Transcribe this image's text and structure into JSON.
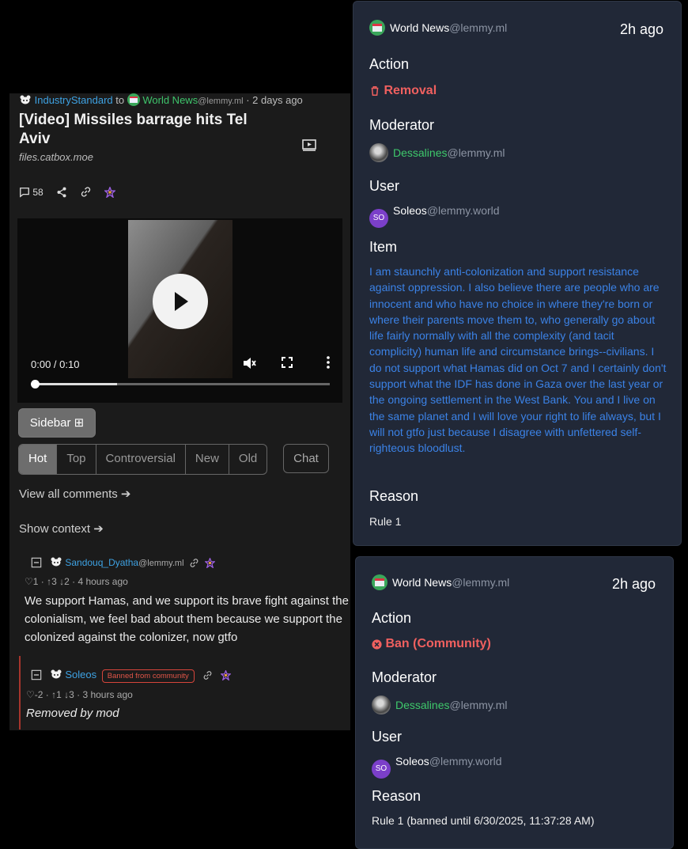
{
  "post": {
    "author": "IndustryStandard",
    "to_word": "to",
    "community": "World News",
    "community_instance": "@lemmy.ml",
    "time": "· 2 days ago",
    "title": "[Video] Missiles barrage hits Tel Aviv",
    "domain": "files.catbox.moe",
    "comment_count": "58",
    "video_time": "0:00 / 0:10",
    "video_progress": 0.28
  },
  "controls": {
    "sidebar_label": "Sidebar ⊞",
    "sort_tabs": [
      "Hot",
      "Top",
      "Controversial",
      "New",
      "Old"
    ],
    "chat_label": "Chat",
    "view_all": "View all comments ➔",
    "show_context": "Show context ➔"
  },
  "comments": [
    {
      "author": "Sandouq_Dyatha",
      "instance": "@lemmy.ml",
      "score_line": "♡1 · ↑3 ↓2 · 4 hours ago",
      "text": "We support Hamas, and we support its brave fight against the colonialism, we feel bad about them because we support the colonized against the colonizer, now gtfo"
    },
    {
      "author": "Soleos",
      "badge": "Banned from community",
      "score_line": "♡-2 · ↑1 ↓3 · 3 hours ago",
      "text": "Removed by mod"
    }
  ],
  "modlog": [
    {
      "community": "World News",
      "community_instance": "@lemmy.ml",
      "ago": "2h ago",
      "action_label": "Action",
      "action": "Removal",
      "moderator_label": "Moderator",
      "moderator": "Dessalines",
      "moderator_instance": "@lemmy.ml",
      "user_label": "User",
      "user_initials": "SO",
      "user": "Soleos",
      "user_instance": "@lemmy.world",
      "item_label": "Item",
      "item": "I am staunchly anti-colonization and support resistance against oppression. I also believe there are people who are innocent and who have no choice in where they're born or where their parents move them to, who generally go about life fairly normally with all the complexity (and tacit complicity) human life and circumstance brings--civilians. I do not support what Hamas did on Oct 7 and I certainly don't support what the IDF has done in Gaza over the last year or the ongoing settlement in the West Bank. You and I live on the same planet and I will love your right to life always, but I will not gtfo just because I disagree with unfettered self-righteous bloodlust.",
      "reason_label": "Reason",
      "reason": "Rule 1"
    },
    {
      "community": "World News",
      "community_instance": "@lemmy.ml",
      "ago": "2h ago",
      "action_label": "Action",
      "action": "Ban (Community)",
      "moderator_label": "Moderator",
      "moderator": "Dessalines",
      "moderator_instance": "@lemmy.ml",
      "user_label": "User",
      "user_initials": "SO",
      "user": "Soleos",
      "user_instance": "@lemmy.world",
      "reason_label": "Reason",
      "reason": "Rule 1 (banned until 6/30/2025, 11:37:28 AM)"
    }
  ],
  "colors": {
    "removal": "#f0605f",
    "moderator": "#3ec96b",
    "item_link": "#3b82e6",
    "user_link": "#3ea2e3"
  },
  "icons": [
    "bear-avatar-icon",
    "community-icon",
    "video-icon",
    "comment-icon",
    "share-icon",
    "link-icon",
    "fediverse-icon",
    "play-icon",
    "mute-icon",
    "fullscreen-icon",
    "more-icon",
    "collapse-icon",
    "heart-icon",
    "trash-icon",
    "x-circle-icon"
  ]
}
